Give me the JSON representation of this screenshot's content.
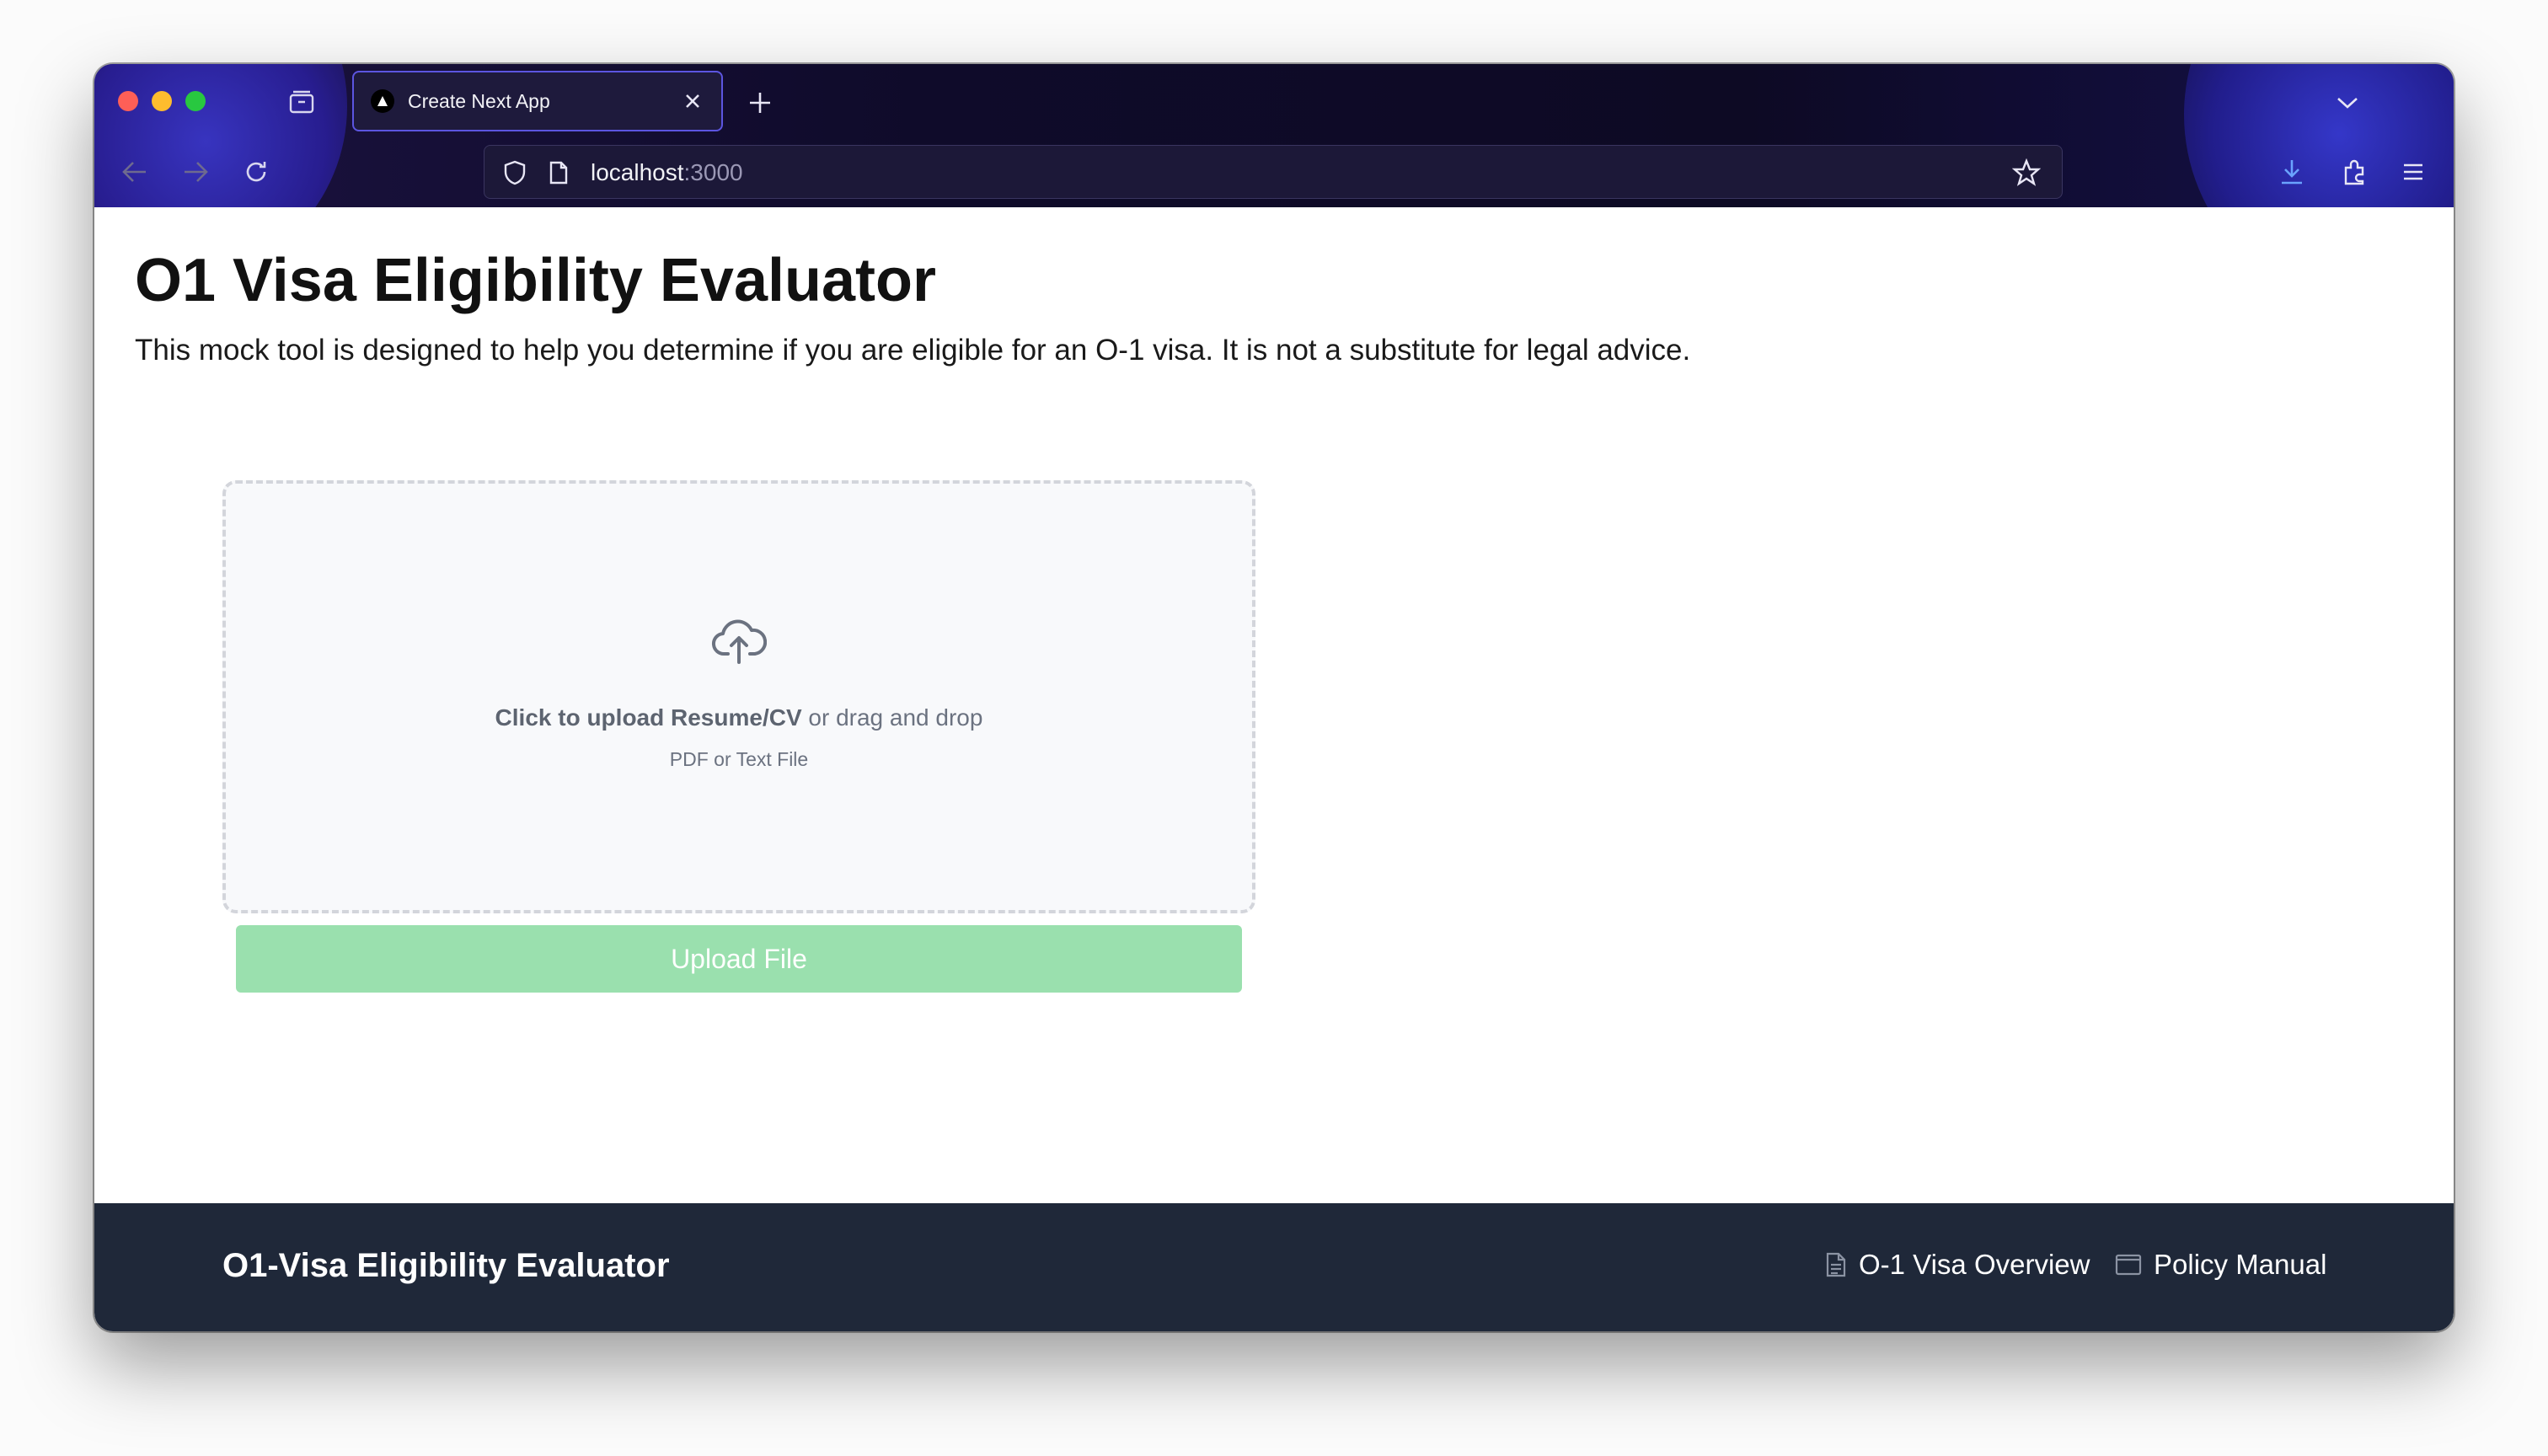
{
  "browser": {
    "tab_title": "Create Next App",
    "url_host": "localhost",
    "url_port": ":3000"
  },
  "page": {
    "title": "O1 Visa Eligibility Evaluator",
    "description": "This mock tool is designed to help you determine if you are eligible for an O-1 visa. It is not a substitute for legal advice.",
    "dropzone": {
      "strong_text": "Click to upload Resume/CV",
      "rest_text": " or drag and drop",
      "hint": "PDF or Text File"
    },
    "upload_button": "Upload File"
  },
  "footer": {
    "brand": "O1-Visa Eligibility Evaluator",
    "links": [
      {
        "label": "O-1 Visa Overview",
        "icon": "document-icon"
      },
      {
        "label": "Policy Manual",
        "icon": "window-icon"
      }
    ]
  },
  "colors": {
    "upload_button_bg": "#9ae0ae",
    "footer_bg": "#1f2839",
    "tab_border": "#5c55e0"
  }
}
